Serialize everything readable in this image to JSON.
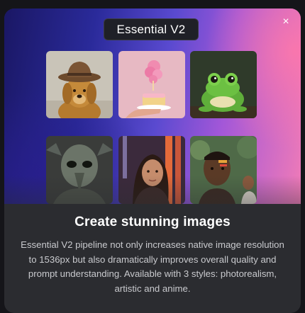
{
  "modal": {
    "badge_label": "Essential V2",
    "close_glyph": "×",
    "close_icon": "close-icon",
    "headline": "Create stunning images",
    "description": "Essential V2 pipeline not only increases native image resolution to 1536px but also dramatically improves overall quality and prompt understanding. Available with 3 styles: photorealism, artistic and anime."
  },
  "gallery": {
    "images": [
      {
        "subject": "golden retriever wearing a brown hat"
      },
      {
        "subject": "hand holding a cake with pink smoke"
      },
      {
        "subject": "green frog on a branch"
      },
      {
        "subject": "alien creature portrait"
      },
      {
        "subject": "woman in city at night"
      },
      {
        "subject": "man with face paint"
      }
    ]
  },
  "colors": {
    "background": "#151519",
    "modal_panel": "#2b2c30",
    "hero_gradient_start": "#1a1764",
    "hero_gradient_end": "#f07bb7",
    "badge_background": "#1f2027",
    "text_primary": "#ffffff",
    "text_secondary": "#c9cace"
  }
}
